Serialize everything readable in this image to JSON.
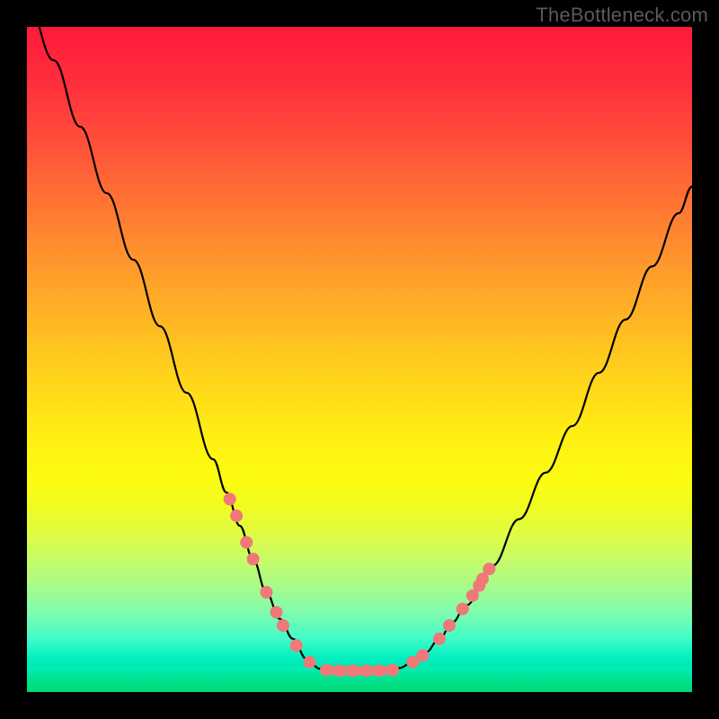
{
  "watermark": "TheBottleneck.com",
  "colors": {
    "curve_stroke": "#000000",
    "dot_fill": "#f07878",
    "dot_stroke": "#d85858"
  },
  "chart_data": {
    "type": "line",
    "title": "",
    "xlabel": "",
    "ylabel": "",
    "xlim": [
      0,
      100
    ],
    "ylim": [
      0,
      100
    ],
    "series": [
      {
        "name": "left-curve",
        "x": [
          0,
          4,
          8,
          12,
          16,
          20,
          24,
          28,
          30,
          32,
          34,
          36,
          38,
          40,
          42,
          43,
          44,
          45
        ],
        "values": [
          104,
          95,
          85,
          75,
          65,
          55,
          45,
          35,
          30,
          25,
          20,
          15,
          11,
          8,
          5,
          4,
          3.5,
          3.3
        ]
      },
      {
        "name": "right-curve",
        "x": [
          55,
          56,
          58,
          60,
          62,
          64,
          66,
          70,
          74,
          78,
          82,
          86,
          90,
          94,
          98,
          100
        ],
        "values": [
          3.3,
          3.6,
          4.5,
          6,
          8,
          10.5,
          13,
          19,
          26,
          33,
          40,
          48,
          56,
          64,
          72,
          76
        ]
      },
      {
        "name": "bottom-flat",
        "x": [
          45,
          47,
          49,
          51,
          53,
          55
        ],
        "values": [
          3.3,
          3.2,
          3.2,
          3.2,
          3.2,
          3.3
        ]
      }
    ],
    "dots": [
      {
        "x": 30.5,
        "y": 29
      },
      {
        "x": 31.5,
        "y": 26.5
      },
      {
        "x": 33,
        "y": 22.5
      },
      {
        "x": 34,
        "y": 20
      },
      {
        "x": 36,
        "y": 15
      },
      {
        "x": 37.5,
        "y": 12
      },
      {
        "x": 38.5,
        "y": 10
      },
      {
        "x": 40.5,
        "y": 7
      },
      {
        "x": 42.5,
        "y": 4.5
      },
      {
        "x": 45,
        "y": 3.3
      },
      {
        "x": 47,
        "y": 3.2
      },
      {
        "x": 49,
        "y": 3.2
      },
      {
        "x": 51,
        "y": 3.2
      },
      {
        "x": 53,
        "y": 3.2
      },
      {
        "x": 55,
        "y": 3.3
      },
      {
        "x": 58,
        "y": 4.5
      },
      {
        "x": 59.5,
        "y": 5.5
      },
      {
        "x": 62,
        "y": 8
      },
      {
        "x": 63.5,
        "y": 10
      },
      {
        "x": 65.5,
        "y": 12.5
      },
      {
        "x": 67,
        "y": 14.5
      },
      {
        "x": 68,
        "y": 16
      },
      {
        "x": 68.5,
        "y": 17
      },
      {
        "x": 69.5,
        "y": 18.5
      }
    ]
  }
}
